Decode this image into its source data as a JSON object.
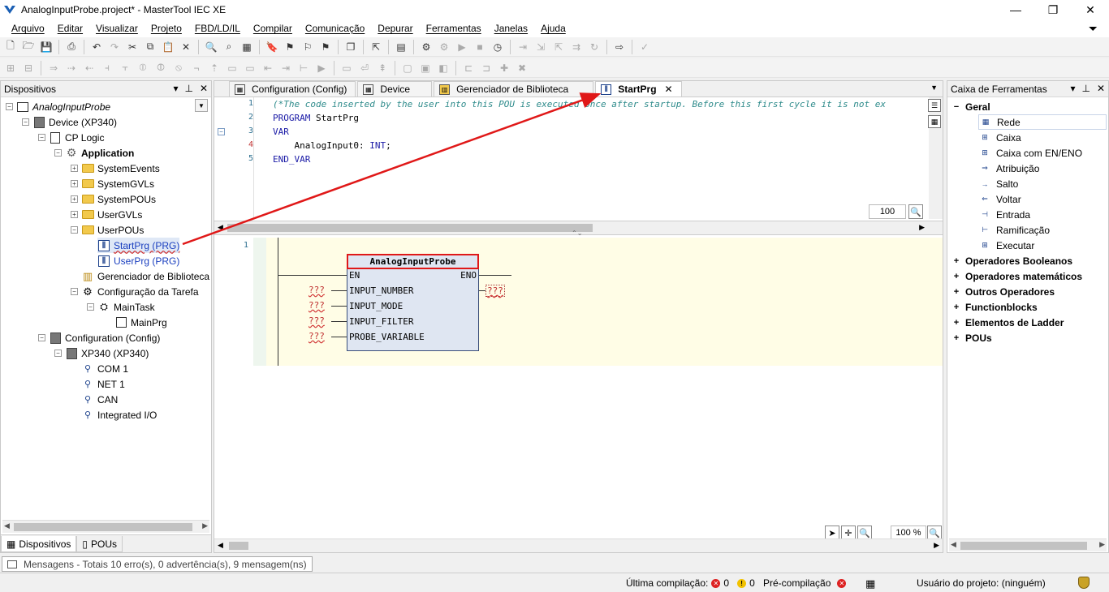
{
  "window": {
    "title": "AnalogInputProbe.project* - MasterTool IEC XE",
    "buttons": {
      "minimize": "—",
      "restore": "❐",
      "close": "✕"
    }
  },
  "menu": {
    "items": [
      "Arquivo",
      "Editar",
      "Visualizar",
      "Projeto",
      "FBD/LD/IL",
      "Compilar",
      "Comunicação",
      "Depurar",
      "Ferramentas",
      "Janelas",
      "Ajuda"
    ]
  },
  "devices_panel": {
    "title": "Dispositivos",
    "tree": [
      {
        "label": "AnalogInputProbe",
        "icon": "project-icon"
      },
      {
        "label": "Device (XP340)",
        "icon": "device-icon"
      },
      {
        "label": "CP Logic",
        "icon": "plc-logic-icon"
      },
      {
        "label": "Application",
        "icon": "application-gear-icon"
      },
      {
        "label": "SystemEvents",
        "icon": "folder-icon"
      },
      {
        "label": "SystemGVLs",
        "icon": "folder-icon"
      },
      {
        "label": "SystemPOUs",
        "icon": "folder-icon"
      },
      {
        "label": "UserGVLs",
        "icon": "folder-icon"
      },
      {
        "label": "UserPOUs",
        "icon": "folder-icon"
      },
      {
        "label": "StartPrg (PRG)",
        "icon": "pou-icon"
      },
      {
        "label": "UserPrg (PRG)",
        "icon": "pou-icon"
      },
      {
        "label": "Gerenciador de Biblioteca",
        "icon": "library-icon"
      },
      {
        "label": "Configuração da Tarefa",
        "icon": "task-config-icon"
      },
      {
        "label": "MainTask",
        "icon": "task-icon"
      },
      {
        "label": "MainPrg",
        "icon": "program-call-icon"
      },
      {
        "label": "Configuration (Config)",
        "icon": "config-icon"
      },
      {
        "label": "XP340 (XP340)",
        "icon": "device-icon"
      },
      {
        "label": "COM 1",
        "icon": "port-icon"
      },
      {
        "label": "NET 1",
        "icon": "port-icon"
      },
      {
        "label": "CAN",
        "icon": "port-icon"
      },
      {
        "label": "Integrated I/O",
        "icon": "port-icon"
      }
    ],
    "bottom_tabs": [
      "Dispositivos",
      "POUs"
    ]
  },
  "editor": {
    "tabs": [
      "Configuration (Config)",
      "Device",
      "Gerenciador de Biblioteca",
      "StartPrg"
    ],
    "active_tab": "StartPrg",
    "code_lines": [
      {
        "n": "1",
        "text": "(*The code inserted by the user into this POU is executed once after startup. Before this first cycle it is not ex"
      },
      {
        "n": "2",
        "kw": "PROGRAM",
        "rest": " StartPrg"
      },
      {
        "n": "3",
        "kw": "VAR",
        "rest": ""
      },
      {
        "n": "4",
        "pre": "    AnalogInput0: ",
        "kw": "INT",
        "rest": ";"
      },
      {
        "n": "5",
        "kw": "END_VAR",
        "rest": ""
      }
    ],
    "decl_zoom": "100",
    "network_number": "1",
    "block": {
      "name": "AnalogInputProbe",
      "en": "EN",
      "eno": "ENO",
      "inputs": [
        "INPUT_NUMBER",
        "INPUT_MODE",
        "INPUT_FILTER",
        "PROBE_VARIABLE"
      ],
      "placeholder": "???"
    },
    "impl_zoom": "100 %"
  },
  "toolbox": {
    "title": "Caixa de Ferramentas",
    "general_label": "Geral",
    "general_items": [
      {
        "label": "Rede",
        "icon": "network-icon"
      },
      {
        "label": "Caixa",
        "icon": "box-icon"
      },
      {
        "label": "Caixa com EN/ENO",
        "icon": "box-en-eno-icon"
      },
      {
        "label": "Atribuição",
        "icon": "assignment-icon"
      },
      {
        "label": "Salto",
        "icon": "jump-icon"
      },
      {
        "label": "Voltar",
        "icon": "return-icon"
      },
      {
        "label": "Entrada",
        "icon": "input-icon"
      },
      {
        "label": "Ramificação",
        "icon": "branch-icon"
      },
      {
        "label": "Executar",
        "icon": "execute-icon"
      }
    ],
    "categories": [
      "Operadores Booleanos",
      "Operadores matemáticos",
      "Outros Operadores",
      "Functionblocks",
      "Elementos de Ladder",
      "POUs"
    ]
  },
  "messages": {
    "text": "Mensagens - Totais 10 erro(s), 0 advertência(s), 9 mensagem(ns)"
  },
  "status": {
    "last_compile_label": "Última compilação:",
    "errors": "0",
    "warnings": "0",
    "precompile_label": "Pré-compilação",
    "project_user": "Usuário do projeto: (ninguém)"
  },
  "colors": {
    "annotation_arrow": "#e01818",
    "block_fill": "#dfe6f2",
    "fbd_background": "#fffde6",
    "link_text": "#1a3fbf"
  }
}
